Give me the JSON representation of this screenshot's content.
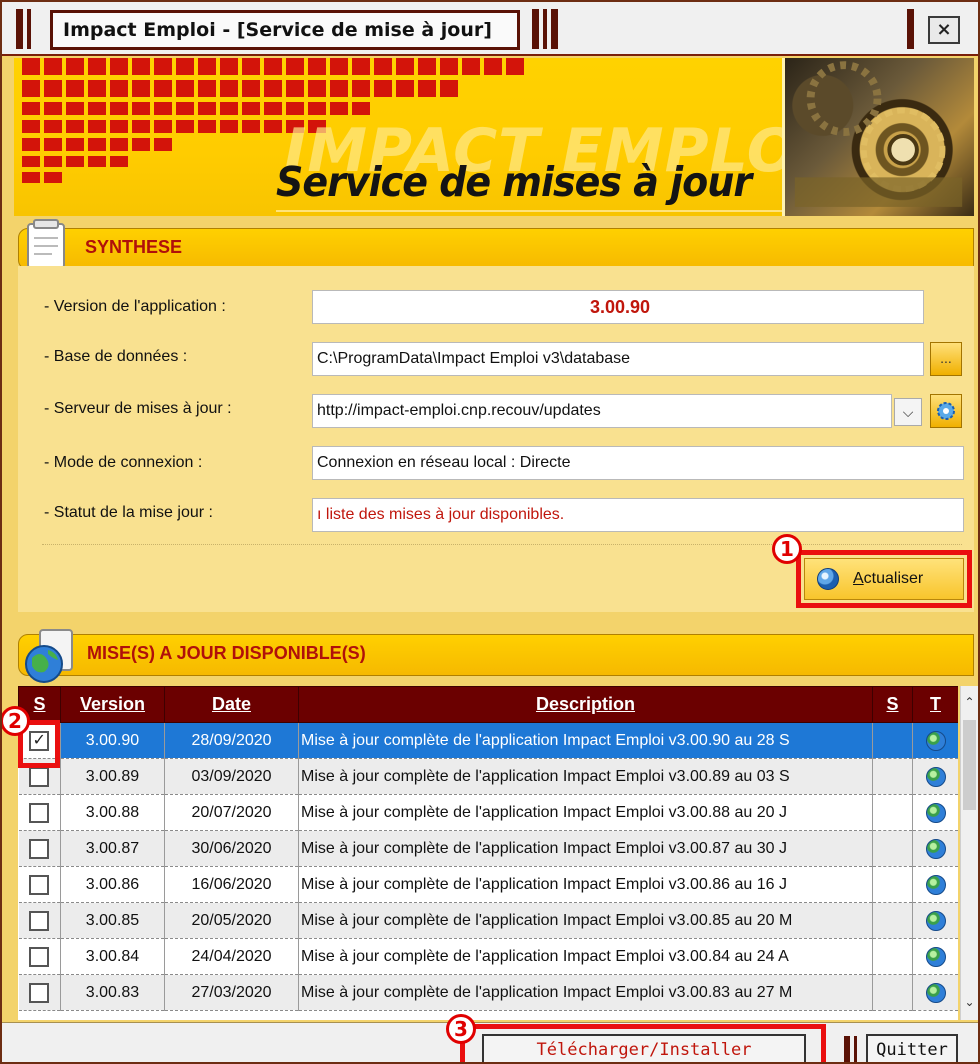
{
  "window": {
    "title": "Impact Emploi - [Service de mise à jour]",
    "close_glyph": "×"
  },
  "banner": {
    "brand_text": "IMPACT EMPLOI",
    "title": "Service de mises à jour"
  },
  "synthese": {
    "section_title": "SYNTHESE",
    "rows": {
      "version": {
        "label": "- Version de l'application :",
        "value": "3.00.90"
      },
      "database": {
        "label": "- Base de données :",
        "value": "C:\\ProgramData\\Impact Emploi v3\\database",
        "browse_label": "..."
      },
      "server": {
        "label": "- Serveur de mises à jour :",
        "value": "http://impact-emploi.cnp.recouv/updates"
      },
      "connection": {
        "label": "- Mode de connexion :",
        "value": "Connexion en réseau local : Directe"
      },
      "status": {
        "label": "- Statut de la mise jour :",
        "value": "ı liste des mises à jour disponibles."
      }
    },
    "refresh_button": {
      "accesskey": "A",
      "rest": "ctualiser"
    }
  },
  "updates": {
    "section_title": "MISE(S) A JOUR DISPONIBLE(S)",
    "columns": {
      "sel": "S",
      "version": "Version",
      "date": "Date",
      "description": "Description",
      "size": "S",
      "type": "T"
    },
    "rows": [
      {
        "checked": true,
        "version": "3.00.90",
        "date": "28/09/2020",
        "description": "Mise à jour complète de l'application Impact Emploi v3.00.90 au 28 S"
      },
      {
        "checked": false,
        "version": "3.00.89",
        "date": "03/09/2020",
        "description": "Mise à jour complète de l'application Impact Emploi v3.00.89 au 03 S"
      },
      {
        "checked": false,
        "version": "3.00.88",
        "date": "20/07/2020",
        "description": "Mise à jour complète de l'application Impact Emploi v3.00.88 au 20 J"
      },
      {
        "checked": false,
        "version": "3.00.87",
        "date": "30/06/2020",
        "description": "Mise à jour complète de l'application Impact Emploi v3.00.87 au 30 J"
      },
      {
        "checked": false,
        "version": "3.00.86",
        "date": "16/06/2020",
        "description": "Mise à jour complète de l'application Impact Emploi v3.00.86 au 16 J"
      },
      {
        "checked": false,
        "version": "3.00.85",
        "date": "20/05/2020",
        "description": "Mise à jour complète de l'application Impact Emploi v3.00.85 au 20 M"
      },
      {
        "checked": false,
        "version": "3.00.84",
        "date": "24/04/2020",
        "description": "Mise à jour complète de l'application Impact Emploi v3.00.84 au 24 A"
      },
      {
        "checked": false,
        "version": "3.00.83",
        "date": "27/03/2020",
        "description": "Mise à jour complète de l'application Impact Emploi v3.00.83 au 27 M"
      }
    ]
  },
  "footer": {
    "install_button": "Télécharger/Installer",
    "quit_button": "Quitter"
  },
  "annotations": {
    "badge_1": "1",
    "badge_2": "2",
    "badge_3": "3"
  },
  "colors": {
    "accent_red": "#c0160c",
    "highlight_red": "#ea0f0f",
    "header_maroon": "#6b0000",
    "banner_yellow": "#ffd200",
    "selection_blue": "#1e78d6"
  }
}
